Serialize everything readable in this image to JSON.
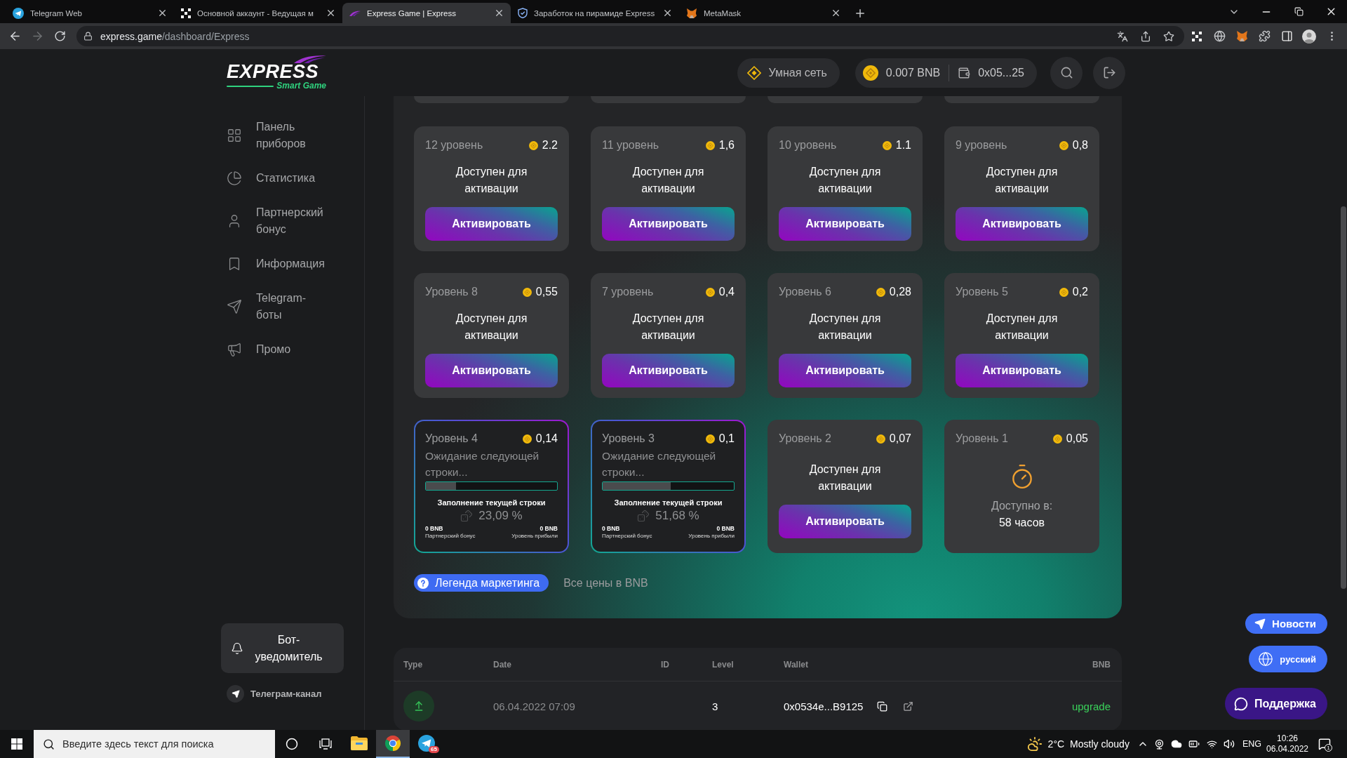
{
  "browser": {
    "tabs": [
      {
        "kind": "telegram",
        "title": "Telegram Web",
        "selected": false
      },
      {
        "kind": "squares",
        "title": "Основной аккаунт - Ведущая м",
        "selected": false
      },
      {
        "kind": "swoosh",
        "title": "Express Game | Express",
        "selected": true
      },
      {
        "kind": "shield",
        "title": "Заработок на пирамиде Express",
        "selected": false
      },
      {
        "kind": "fox",
        "title": "MetaMask",
        "selected": false
      }
    ],
    "url": {
      "host": "express.game",
      "path": "/dashboard/Express"
    }
  },
  "header": {
    "logo": {
      "title": "EXPRESS",
      "subtitle": "Smart Game"
    },
    "network": "Умная сеть",
    "balance": "0.007 BNB",
    "wallet": "0x05...25"
  },
  "sidebar": {
    "items": [
      {
        "label": "Панель приборов",
        "selected": false
      },
      {
        "label": "Статистика",
        "selected": false
      },
      {
        "label": "Партнерский бонус",
        "selected": false
      },
      {
        "label": "Информация",
        "selected": false
      },
      {
        "label": "Telegram-боты",
        "selected": false
      },
      {
        "label": "Промо",
        "selected": false
      }
    ],
    "bot_button": "Бот-уведомитель",
    "channel_link": "Телеграм-канал"
  },
  "levels": {
    "cards": [
      {
        "kind": "available",
        "title": "12 уровень",
        "price": "2.2",
        "status": "Доступен для активации",
        "button": "Активировать"
      },
      {
        "kind": "available",
        "title": "11 уровень",
        "price": "1,6",
        "status": "Доступен для активации",
        "button": "Активировать"
      },
      {
        "kind": "available",
        "title": "10 уровень",
        "price": "1.1",
        "status": "Доступен для активации",
        "button": "Активировать"
      },
      {
        "kind": "available",
        "title": "9 уровень",
        "price": "0,8",
        "status": "Доступен для активации",
        "button": "Активировать"
      },
      {
        "kind": "available",
        "title": "Уровень 8",
        "price": "0,55",
        "status": "Доступен для активации",
        "button": "Активировать"
      },
      {
        "kind": "available",
        "title": "7 уровень",
        "price": "0,4",
        "status": "Доступен для активации",
        "button": "Активировать"
      },
      {
        "kind": "available",
        "title": "Уровень 6",
        "price": "0,28",
        "status": "Доступен для активации",
        "button": "Активировать"
      },
      {
        "kind": "available",
        "title": "Уровень 5",
        "price": "0,2",
        "status": "Доступен для активации",
        "button": "Активировать"
      },
      {
        "kind": "active",
        "title": "Уровень 4",
        "price": "0,14",
        "status": "Ожидание следующей строки...",
        "progress_title": "Заполнение текущей строки",
        "level": 0.2309,
        "percent": "23,09 %",
        "stats": [
          {
            "value": "0 BNB",
            "label": "Партнерский бонус"
          },
          {
            "value": "0 BNB",
            "label": "Уровень прибыли"
          }
        ]
      },
      {
        "kind": "active",
        "title": "Уровень 3",
        "price": "0,1",
        "status": "Ожидание следующей строки...",
        "progress_title": "Заполнение текущей строки",
        "level": 0.5168,
        "percent": "51,68 %",
        "stats": [
          {
            "value": "0 BNB",
            "label": "Партнерский бонус"
          },
          {
            "value": "0 BNB",
            "label": "Уровень прибыли"
          }
        ]
      },
      {
        "kind": "available",
        "title": "Уровень 2",
        "price": "0,07",
        "status": "Доступен для активации",
        "button": "Активировать"
      },
      {
        "kind": "timer",
        "title": "Уровень 1",
        "price": "0,05",
        "status": "Доступно в:",
        "time": "58 часов"
      }
    ],
    "legend_button": "Легенда маркетинга",
    "note": "Все цены в BNB"
  },
  "transactions": {
    "columns": [
      "Type",
      "Date",
      "ID",
      "Level",
      "Wallet",
      "BNB"
    ],
    "rows": [
      {
        "date": "06.04.2022 07:09",
        "level": "3",
        "wallet": "0x0534e...B9125",
        "bnb": "upgrade"
      }
    ]
  },
  "floating": {
    "news": "Новости",
    "language": "русский",
    "support": "Поддержка"
  },
  "taskbar": {
    "search_placeholder": "Введите здесь текст для поиска",
    "apps": [
      {
        "kind": "explorer",
        "selected": false
      },
      {
        "kind": "browser",
        "selected": true
      },
      {
        "kind": "telegram",
        "selected": false,
        "badge": "65"
      }
    ],
    "weather": {
      "temperature": "2°C",
      "condition": "Mostly cloudy"
    },
    "language": "ENG",
    "time": "10:26",
    "date": "06.04.2022",
    "notifications": "1"
  }
}
